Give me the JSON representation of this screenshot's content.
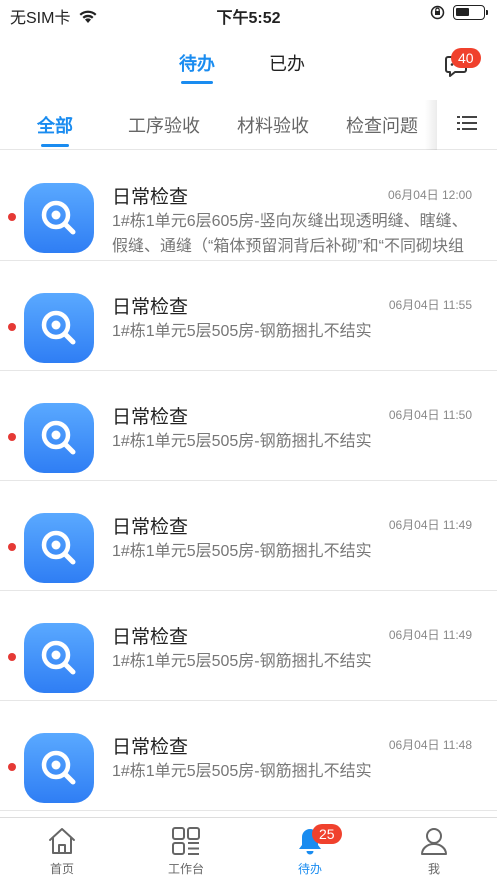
{
  "status_bar": {
    "carrier": "无SIM卡",
    "time": "下午5:52",
    "battery_level": 0.5
  },
  "top_tabs": [
    {
      "label": "待办",
      "active": true
    },
    {
      "label": "已办",
      "active": false
    }
  ],
  "message_badge": "40",
  "categories": [
    {
      "label": "全部",
      "active": true
    },
    {
      "label": "工序验收",
      "active": false
    },
    {
      "label": "材料验收",
      "active": false
    },
    {
      "label": "检查问题",
      "active": false
    }
  ],
  "items": [
    {
      "title": "日常检查",
      "time": "06月04日 12:00",
      "desc": "1#栋1单元6层605房-竖向灰缝出现透明缝、瞎缝、假缝、通缝（“箱体预留洞背后补砌”和“不同砌块组",
      "unread": true
    },
    {
      "title": "日常检查",
      "time": "06月04日 11:55",
      "desc": "1#栋1单元5层505房-钢筋捆扎不结实",
      "unread": true
    },
    {
      "title": "日常检查",
      "time": "06月04日 11:50",
      "desc": "1#栋1单元5层505房-钢筋捆扎不结实",
      "unread": true
    },
    {
      "title": "日常检查",
      "time": "06月04日 11:49",
      "desc": "1#栋1单元5层505房-钢筋捆扎不结实",
      "unread": true
    },
    {
      "title": "日常检查",
      "time": "06月04日 11:49",
      "desc": "1#栋1单元5层505房-钢筋捆扎不结实",
      "unread": true
    },
    {
      "title": "日常检查",
      "time": "06月04日 11:48",
      "desc": "1#栋1单元5层505房-钢筋捆扎不结实",
      "unread": true
    }
  ],
  "bottom_nav": [
    {
      "label": "首页",
      "icon": "home-icon",
      "active": false
    },
    {
      "label": "工作台",
      "icon": "grid-icon",
      "active": false
    },
    {
      "label": "待办",
      "icon": "bell-icon",
      "active": true,
      "badge": "25"
    },
    {
      "label": "我",
      "icon": "person-icon",
      "active": false
    }
  ],
  "colors": {
    "accent": "#1a8cf0",
    "badge": "#f0412d",
    "unread_dot": "#e53935"
  }
}
